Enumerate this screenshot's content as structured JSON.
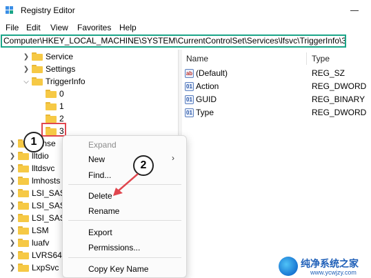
{
  "window": {
    "title": "Registry Editor"
  },
  "menubar": {
    "items": [
      "File",
      "Edit",
      "View",
      "Favorites",
      "Help"
    ]
  },
  "address": {
    "path": "Computer\\HKEY_LOCAL_MACHINE\\SYSTEM\\CurrentControlSet\\Services\\lfsvc\\TriggerInfo\\3"
  },
  "tree": {
    "items": [
      {
        "label": "Service",
        "expanded": false
      },
      {
        "label": "Settings",
        "expanded": false
      },
      {
        "label": "TriggerInfo",
        "expanded": true
      },
      {
        "label": "0"
      },
      {
        "label": "1"
      },
      {
        "label": "2"
      },
      {
        "label": "3",
        "selected": true
      },
      {
        "label": "icense"
      },
      {
        "label": "lltdio"
      },
      {
        "label": "lltdsvc"
      },
      {
        "label": "lmhosts"
      },
      {
        "label": "LSI_SAS"
      },
      {
        "label": "LSI_SAS"
      },
      {
        "label": "LSI_SAS"
      },
      {
        "label": "LSM"
      },
      {
        "label": "luafv"
      },
      {
        "label": "LVRS64"
      },
      {
        "label": "LxpSvc"
      }
    ]
  },
  "list": {
    "columns": {
      "name": "Name",
      "type": "Type"
    },
    "rows": [
      {
        "name": "(Default)",
        "type": "REG_SZ",
        "icon": "ab"
      },
      {
        "name": "Action",
        "type": "REG_DWORD",
        "icon": "bin"
      },
      {
        "name": "GUID",
        "type": "REG_BINARY",
        "icon": "bin"
      },
      {
        "name": "Type",
        "type": "REG_DWORD",
        "icon": "bin"
      }
    ]
  },
  "context_menu": {
    "expand": "Expand",
    "new": "New",
    "find": "Find...",
    "delete": "Delete",
    "rename": "Rename",
    "export": "Export",
    "permissions": "Permissions...",
    "copy_key_name": "Copy Key Name"
  },
  "annotations": {
    "step1": "1",
    "step2": "2"
  },
  "watermark": {
    "text": "纯净系统之家",
    "url": "www.ycwjzy.com"
  },
  "colors": {
    "address_border": "#1aa588",
    "highlight_box": "#e0464e",
    "folder": "#f6c945"
  }
}
